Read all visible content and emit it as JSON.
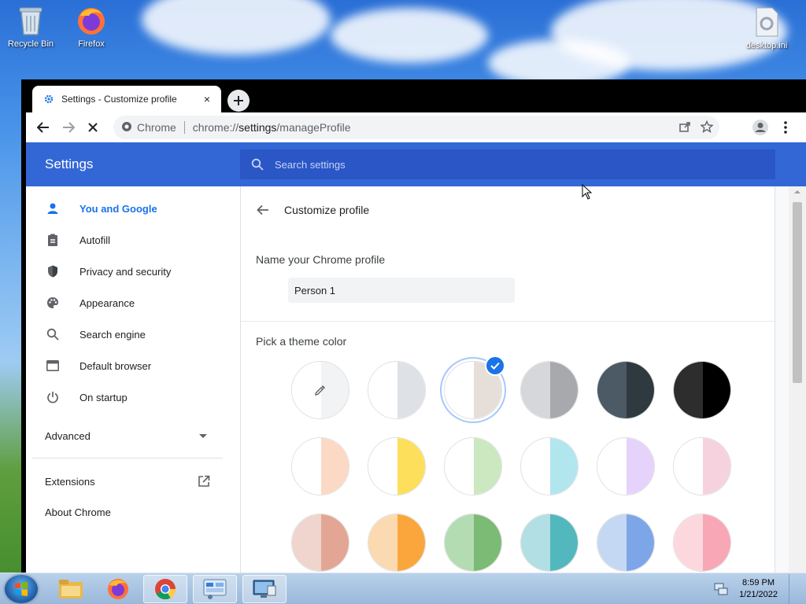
{
  "desktop": {
    "icons": [
      {
        "label": "Recycle Bin"
      },
      {
        "label": "Firefox"
      },
      {
        "label": "desktop.ini"
      }
    ]
  },
  "browser": {
    "tab": {
      "title": "Settings - Customize profile",
      "close": "×"
    },
    "omnibox": {
      "site": "Chrome",
      "url_scheme": "chrome://",
      "url_host": "settings",
      "url_path": "/manageProfile"
    }
  },
  "settings": {
    "header_title": "Settings",
    "search_placeholder": "Search settings",
    "nav": [
      {
        "label": "You and Google",
        "icon": "person-icon",
        "active": true
      },
      {
        "label": "Autofill",
        "icon": "clipboard-icon"
      },
      {
        "label": "Privacy and security",
        "icon": "shield-icon"
      },
      {
        "label": "Appearance",
        "icon": "palette-icon"
      },
      {
        "label": "Search engine",
        "icon": "search-icon"
      },
      {
        "label": "Default browser",
        "icon": "browser-icon"
      },
      {
        "label": "On startup",
        "icon": "power-icon"
      }
    ],
    "advanced_label": "Advanced",
    "extensions_label": "Extensions",
    "about_label": "About Chrome"
  },
  "customize": {
    "title": "Customize profile",
    "name_label": "Name your Chrome profile",
    "name_value": "Person 1",
    "theme_label": "Pick a theme color",
    "swatches": [
      {
        "left": "#ffffff",
        "right": "#f1f3f4",
        "picker": true
      },
      {
        "left": "#ffffff",
        "right": "#dee1e6"
      },
      {
        "left": "#ffffff",
        "right": "#e6dfd9",
        "selected": true
      },
      {
        "left": "#d6d7db",
        "right": "#a7a9ad"
      },
      {
        "left": "#4b5a64",
        "right": "#2f3a40"
      },
      {
        "left": "#2d2d2d",
        "right": "#000000"
      },
      {
        "left": "#ffffff",
        "right": "#fbd9c4"
      },
      {
        "left": "#ffffff",
        "right": "#fddf5c"
      },
      {
        "left": "#ffffff",
        "right": "#cbe8c1"
      },
      {
        "left": "#ffffff",
        "right": "#b2e6ef"
      },
      {
        "left": "#ffffff",
        "right": "#e6d3fb"
      },
      {
        "left": "#ffffff",
        "right": "#f6d2df"
      },
      {
        "left": "#f0d5cf",
        "right": "#e3a695"
      },
      {
        "left": "#fbdab2",
        "right": "#fba63c"
      },
      {
        "left": "#b4dcb2",
        "right": "#7cbb75"
      },
      {
        "left": "#b1dfe3",
        "right": "#53b8bd"
      },
      {
        "left": "#c5d8f3",
        "right": "#7da6e8"
      },
      {
        "left": "#fcd8de",
        "right": "#f7a7b5"
      }
    ]
  },
  "taskbar": {
    "time": "8:59 PM",
    "date": "1/21/2022"
  },
  "colors": {
    "accent": "#1a73e8",
    "settings_header": "#3367d6",
    "search_bar": "#2a56c6"
  }
}
